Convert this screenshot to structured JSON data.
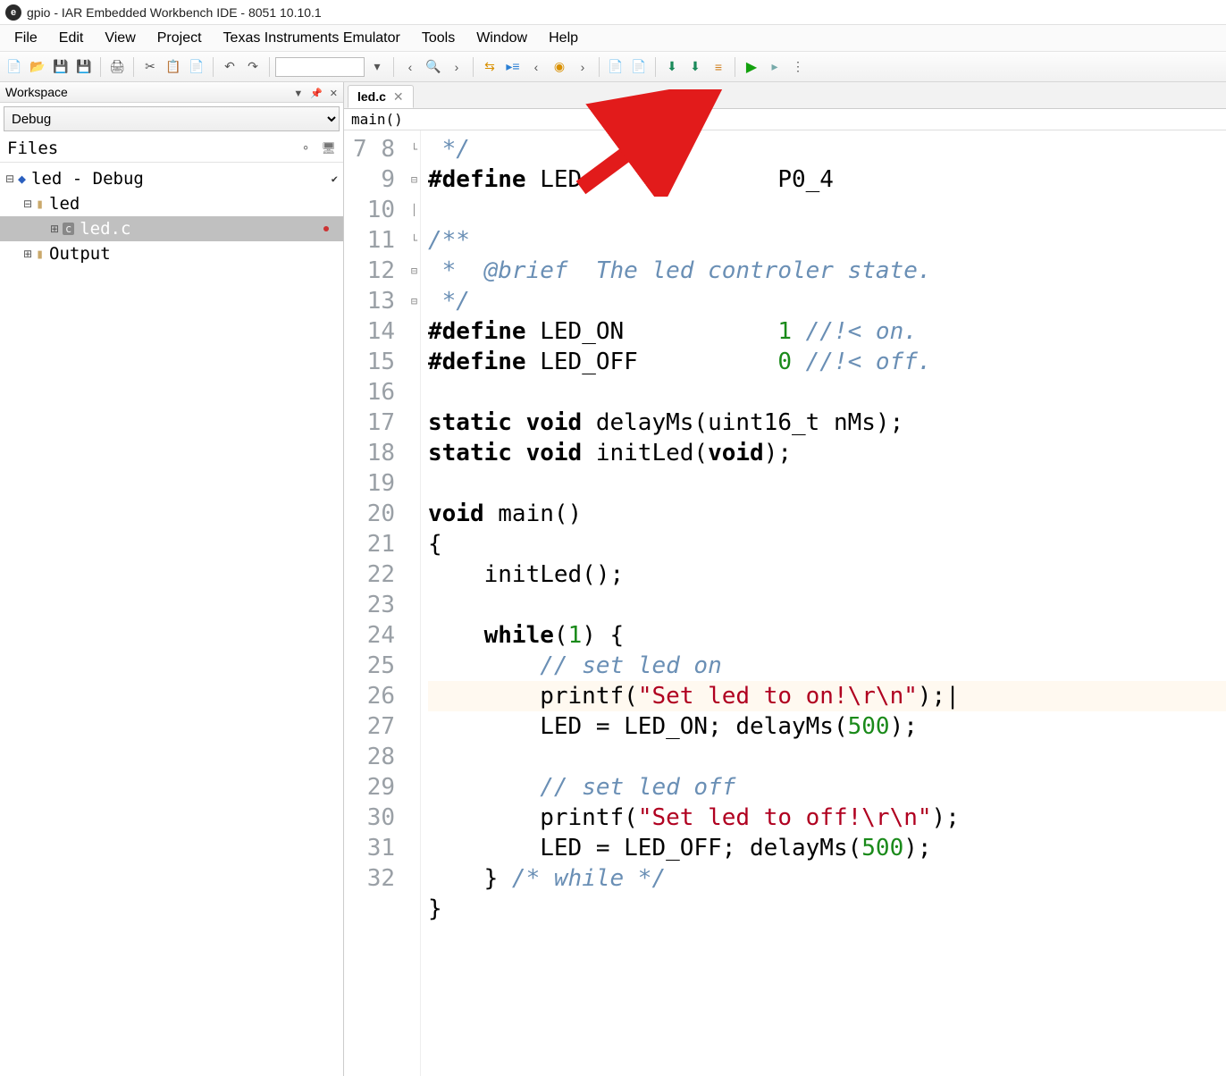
{
  "title": "gpio - IAR Embedded Workbench IDE - 8051 10.10.1",
  "menus": [
    "File",
    "Edit",
    "View",
    "Project",
    "Texas Instruments Emulator",
    "Tools",
    "Window",
    "Help"
  ],
  "workspace": {
    "header": "Workspace",
    "config": "Debug",
    "filesHeader": "Files",
    "tree": {
      "root": "led - Debug",
      "folder1": "led",
      "file1": "led.c",
      "folder2": "Output"
    }
  },
  "tab": {
    "name": "led.c"
  },
  "funcbar": "main()",
  "code": {
    "lines": {
      "7": {
        "fold": "└",
        "tokens": [
          {
            "t": " */",
            "c": "cm"
          }
        ]
      },
      "8": {
        "tokens": [
          {
            "t": "#define ",
            "c": "kw"
          },
          {
            "t": "LED              P0_4",
            "c": "id"
          }
        ]
      },
      "9": {
        "tokens": [
          {
            "t": "",
            "c": "id"
          }
        ]
      },
      "10": {
        "fold": "⊟",
        "tokens": [
          {
            "t": "/**",
            "c": "cm"
          }
        ]
      },
      "11": {
        "fold": "│",
        "tokens": [
          {
            "t": " *  @brief  The led controler state.",
            "c": "cm"
          }
        ]
      },
      "12": {
        "fold": "└",
        "tokens": [
          {
            "t": " */",
            "c": "cm"
          }
        ]
      },
      "13": {
        "tokens": [
          {
            "t": "#define ",
            "c": "kw"
          },
          {
            "t": "LED_ON           ",
            "c": "id"
          },
          {
            "t": "1",
            "c": "num"
          },
          {
            "t": " //!< on.",
            "c": "cm"
          }
        ]
      },
      "14": {
        "tokens": [
          {
            "t": "#define ",
            "c": "kw"
          },
          {
            "t": "LED_OFF          ",
            "c": "id"
          },
          {
            "t": "0",
            "c": "num"
          },
          {
            "t": " //!< off.",
            "c": "cm"
          }
        ]
      },
      "15": {
        "tokens": [
          {
            "t": "",
            "c": "id"
          }
        ]
      },
      "16": {
        "tokens": [
          {
            "t": "static void ",
            "c": "kw"
          },
          {
            "t": "delayMs(uint16_t nMs);",
            "c": "id"
          }
        ]
      },
      "17": {
        "tokens": [
          {
            "t": "static void ",
            "c": "kw"
          },
          {
            "t": "initLed(",
            "c": "id"
          },
          {
            "t": "void",
            "c": "kw"
          },
          {
            "t": ");",
            "c": "id"
          }
        ]
      },
      "18": {
        "tokens": [
          {
            "t": "",
            "c": "id"
          }
        ]
      },
      "19": {
        "tokens": [
          {
            "t": "void ",
            "c": "kw"
          },
          {
            "t": "main()",
            "c": "id"
          }
        ]
      },
      "20": {
        "fold": "⊟",
        "tokens": [
          {
            "t": "{",
            "c": "id"
          }
        ]
      },
      "21": {
        "tokens": [
          {
            "t": "    initLed();",
            "c": "id"
          }
        ]
      },
      "22": {
        "tokens": [
          {
            "t": "",
            "c": "id"
          }
        ]
      },
      "23": {
        "fold": "⊟",
        "tokens": [
          {
            "t": "    ",
            "c": "id"
          },
          {
            "t": "while",
            "c": "kw"
          },
          {
            "t": "(",
            "c": "id"
          },
          {
            "t": "1",
            "c": "num"
          },
          {
            "t": ") {",
            "c": "id"
          }
        ]
      },
      "24": {
        "tokens": [
          {
            "t": "        ",
            "c": "id"
          },
          {
            "t": "// set led on",
            "c": "cm"
          }
        ]
      },
      "25": {
        "hl": true,
        "tokens": [
          {
            "t": "        printf(",
            "c": "id"
          },
          {
            "t": "\"Set led to on!\\r\\n\"",
            "c": "str"
          },
          {
            "t": ");|",
            "c": "id"
          }
        ]
      },
      "26": {
        "tokens": [
          {
            "t": "        LED = LED_ON; delayMs(",
            "c": "id"
          },
          {
            "t": "500",
            "c": "num"
          },
          {
            "t": ");",
            "c": "id"
          }
        ]
      },
      "27": {
        "tokens": [
          {
            "t": "",
            "c": "id"
          }
        ]
      },
      "28": {
        "tokens": [
          {
            "t": "        ",
            "c": "id"
          },
          {
            "t": "// set led off",
            "c": "cm"
          }
        ]
      },
      "29": {
        "tokens": [
          {
            "t": "        printf(",
            "c": "id"
          },
          {
            "t": "\"Set led to off!\\r\\n\"",
            "c": "str"
          },
          {
            "t": ");",
            "c": "id"
          }
        ]
      },
      "30": {
        "tokens": [
          {
            "t": "        LED = LED_OFF; delayMs(",
            "c": "id"
          },
          {
            "t": "500",
            "c": "num"
          },
          {
            "t": ");",
            "c": "id"
          }
        ]
      },
      "31": {
        "tokens": [
          {
            "t": "    } ",
            "c": "id"
          },
          {
            "t": "/* while */",
            "c": "cm"
          }
        ]
      },
      "32": {
        "tokens": [
          {
            "t": "}",
            "c": "id"
          }
        ]
      }
    },
    "first": 7,
    "last": 32
  }
}
